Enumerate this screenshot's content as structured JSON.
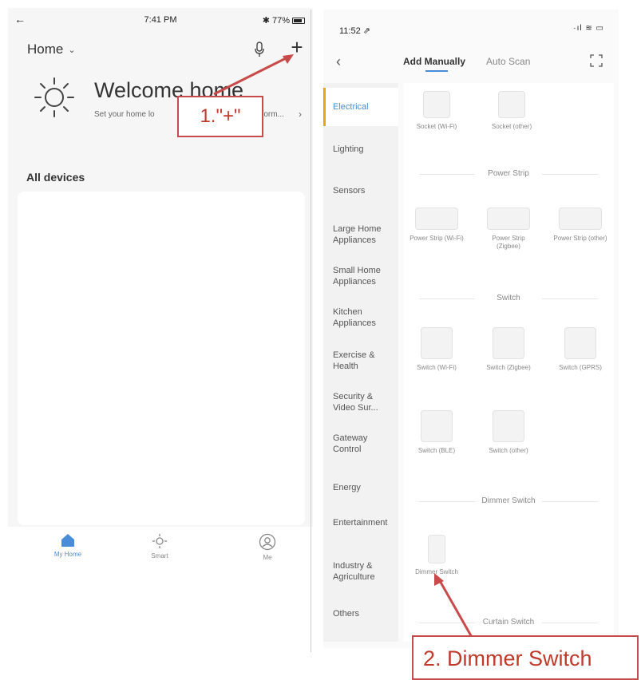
{
  "left": {
    "status": {
      "back": "←",
      "time": "7:41 PM",
      "battery": "✱ 77%"
    },
    "home_selector": {
      "label": "Home",
      "chevron": "⌄"
    },
    "icons": {
      "mic": "mic-icon",
      "add": "+",
      "weather": "sun-icon"
    },
    "welcome": "Welcome home",
    "weather_sub": "Set your home lo",
    "weather_sub_right": "aform...",
    "weather_arrow": "›",
    "devices_title": "All devices",
    "tabs": [
      {
        "label": "My Home",
        "icon": "home-icon",
        "active": true
      },
      {
        "label": "Smart",
        "icon": "smart-sun-icon",
        "active": false
      },
      {
        "label": "Me",
        "icon": "me-icon",
        "active": false
      }
    ],
    "annotation": "1.\"+\""
  },
  "right": {
    "status": {
      "time": "11:52 ⇗",
      "signals": "·ıl ≋ ▭"
    },
    "header": {
      "back": "‹",
      "add_manually": "Add Manually",
      "auto_scan": "Auto Scan"
    },
    "sidebar": [
      "Electrical",
      "Lighting",
      "Sensors",
      "Large Home Appliances",
      "Small Home Appliances",
      "Kitchen Appliances",
      "Exercise & Health",
      "Security & Video Sur...",
      "Gateway Control",
      "Energy",
      "Entertainment",
      "Industry & Agriculture",
      "Others"
    ],
    "sections": {
      "power_strip": "Power Strip",
      "switch": "Switch",
      "dimmer_switch": "Dimmer Switch",
      "curtain_switch": "Curtain Switch"
    },
    "devices": {
      "socket_wifi": "Socket (Wi-Fi)",
      "socket_other": "Socket (other)",
      "strip_wifi": "Power Strip (Wi-Fi)",
      "strip_zigbee": "Power Strip (Zigbee)",
      "strip_other": "Power Strip (other)",
      "switch_wifi": "Switch (Wi-Fi)",
      "switch_zigbee": "Switch (Zigbee)",
      "switch_gprs": "Switch (GPRS)",
      "switch_ble": "Switch (BLE)",
      "switch_other": "Switch (other)",
      "dimmer": "Dimmer Switch"
    },
    "annotation": "2. Dimmer Switch"
  },
  "colors": {
    "accent": "#4a8cd6",
    "annotation": "#c0392b",
    "sidebar_marker": "#f0a020"
  }
}
